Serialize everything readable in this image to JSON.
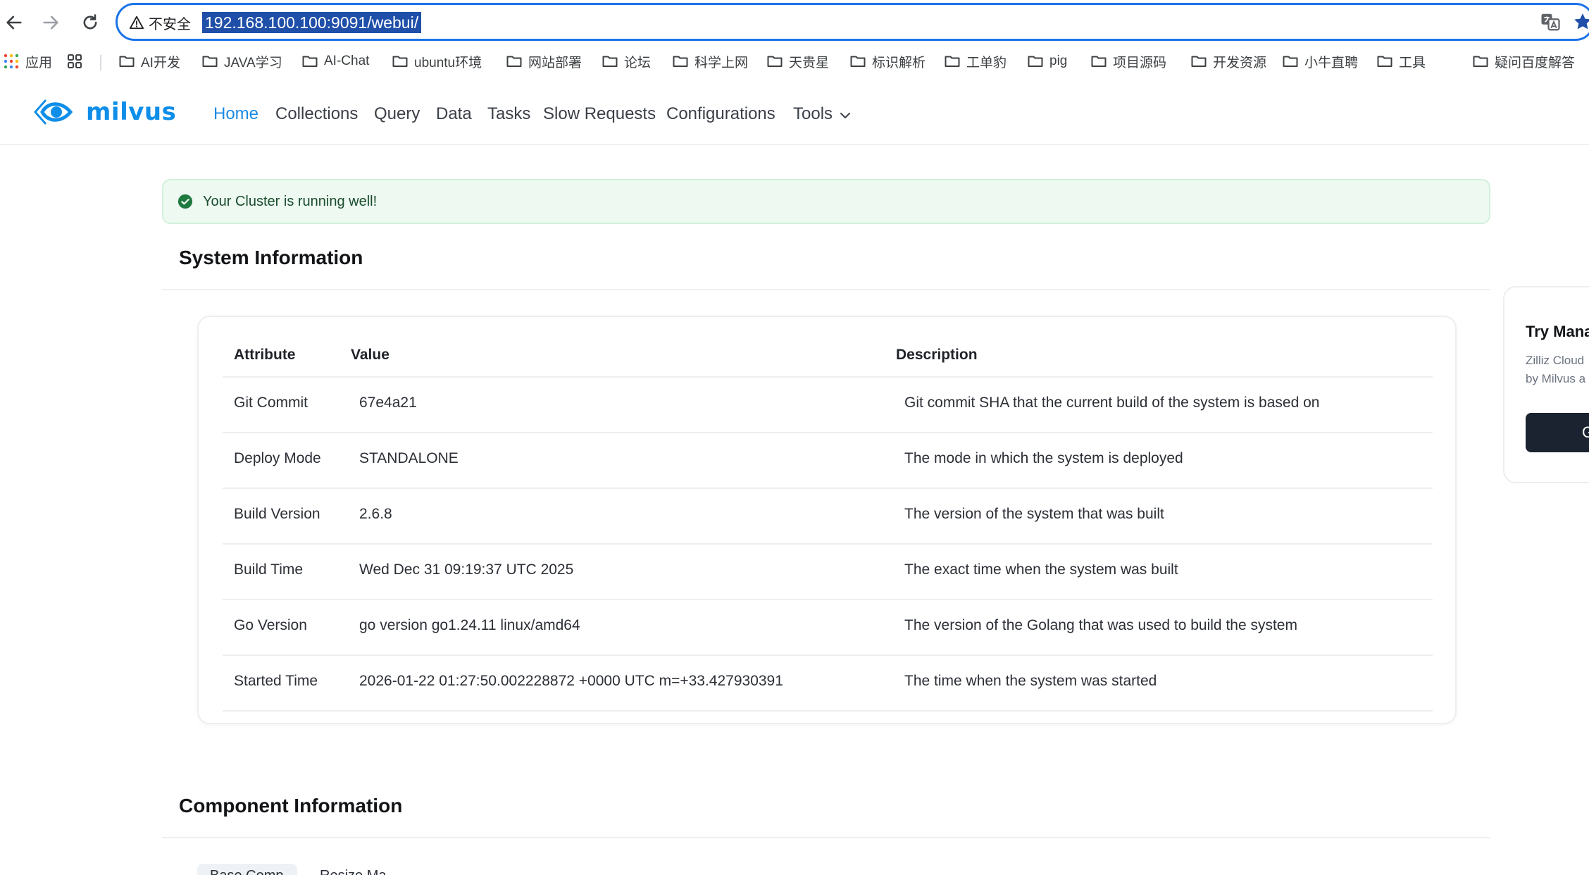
{
  "browser": {
    "insecure_label": "不安全",
    "url": "192.168.100.100:9091/webui/",
    "bookmarks": [
      {
        "label": "应用",
        "icon": "apps-grid-icon"
      },
      {
        "label": "",
        "icon": "tab-groups-icon"
      },
      {
        "label": "AI开发",
        "icon": "folder-icon"
      },
      {
        "label": "JAVA学习",
        "icon": "folder-icon"
      },
      {
        "label": "AI-Chat",
        "icon": "folder-icon"
      },
      {
        "label": "ubuntu环境",
        "icon": "folder-icon"
      },
      {
        "label": "网站部署",
        "icon": "folder-icon"
      },
      {
        "label": "论坛",
        "icon": "folder-icon"
      },
      {
        "label": "科学上网",
        "icon": "folder-icon"
      },
      {
        "label": "天贵星",
        "icon": "folder-icon"
      },
      {
        "label": "标识解析",
        "icon": "folder-icon"
      },
      {
        "label": "工单豹",
        "icon": "folder-icon"
      },
      {
        "label": "pig",
        "icon": "folder-icon"
      },
      {
        "label": "项目源码",
        "icon": "folder-icon"
      },
      {
        "label": "开发资源",
        "icon": "folder-icon"
      },
      {
        "label": "小牛直聘",
        "icon": "folder-icon"
      },
      {
        "label": "工具",
        "icon": "folder-icon"
      },
      {
        "label": "疑问百度解答",
        "icon": "folder-icon"
      }
    ]
  },
  "header": {
    "logo_text": "milvus",
    "nav": [
      "Home",
      "Collections",
      "Query",
      "Data",
      "Tasks",
      "Slow Requests",
      "Configurations",
      "Tools"
    ],
    "active_nav": "Home",
    "accent_color": "#1c8ae3"
  },
  "alert": {
    "text": "Your Cluster is running well!",
    "status_color": "#1f7a3f"
  },
  "system_info": {
    "title": "System Information",
    "columns": [
      "Attribute",
      "Value",
      "Description"
    ],
    "rows": [
      {
        "attribute": "Git Commit",
        "value": "67e4a21",
        "description": "Git commit SHA that the current build of the system is based on"
      },
      {
        "attribute": "Deploy Mode",
        "value": "STANDALONE",
        "description": "The mode in which the system is deployed"
      },
      {
        "attribute": "Build Version",
        "value": "2.6.8",
        "description": "The version of the system that was built"
      },
      {
        "attribute": "Build Time",
        "value": "Wed Dec 31 09:19:37 UTC 2025",
        "description": "The exact time when the system was built"
      },
      {
        "attribute": "Go Version",
        "value": "go version go1.24.11 linux/amd64",
        "description": "The version of the Golang that was used to build the system"
      },
      {
        "attribute": "Started Time",
        "value": "2026-01-22 01:27:50.002228872 +0000 UTC m=+33.427930391",
        "description": "The time when the system was started"
      }
    ]
  },
  "side_card": {
    "title": "Try Mana",
    "desc_line1": "Zilliz Cloud",
    "desc_line2": "by Milvus a",
    "button_label": "G"
  },
  "component_info": {
    "title": "Component Information",
    "tabs": [
      "Base Comp",
      "Resize Ma"
    ]
  }
}
